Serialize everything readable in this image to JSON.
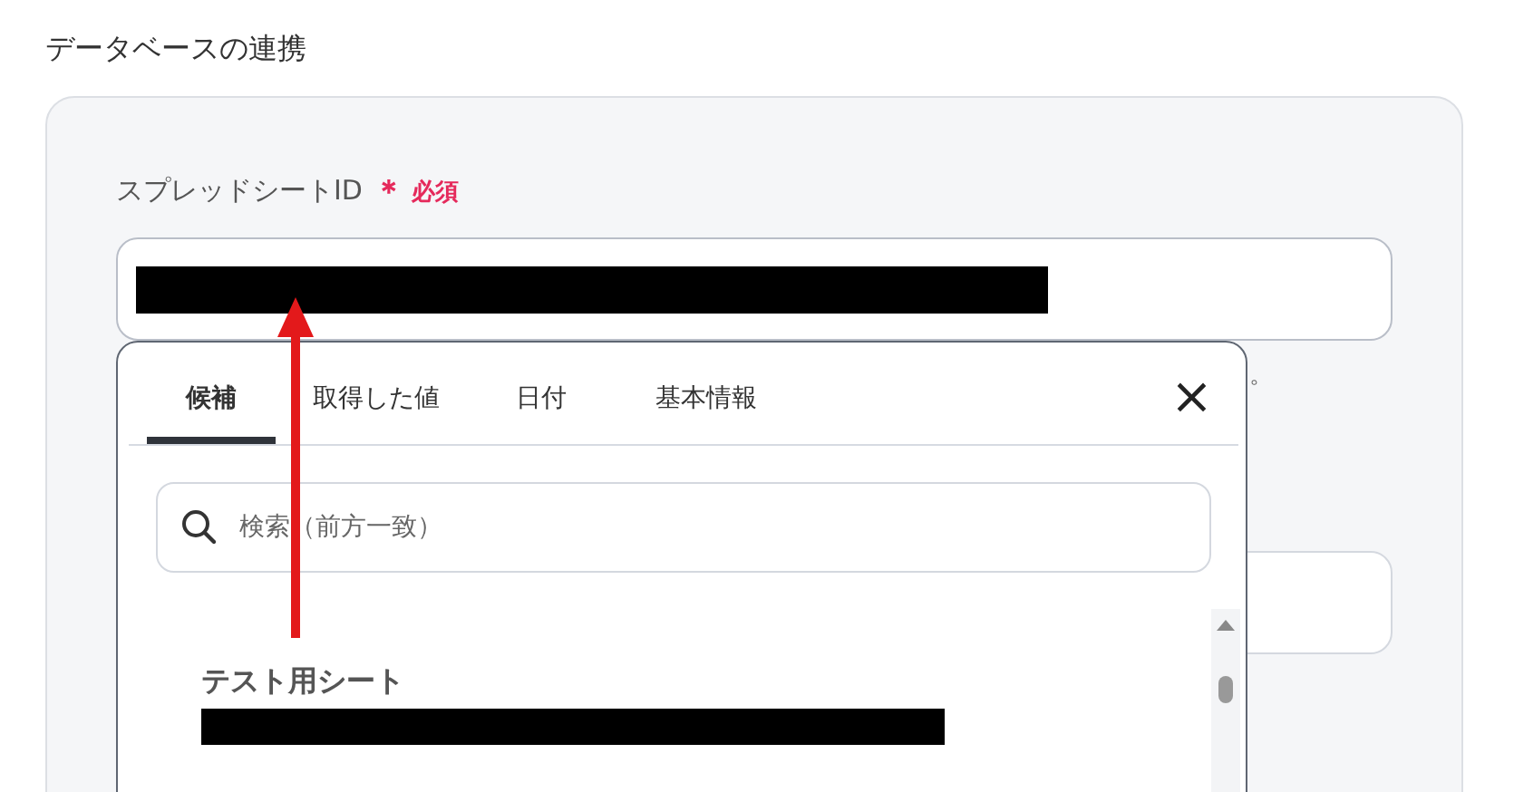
{
  "section_title": "データベースの連携",
  "field": {
    "label": "スプレッドシートID",
    "required_mark": "＊",
    "required_text": "必須",
    "hint_visible": "。"
  },
  "popup": {
    "tabs": [
      {
        "label": "候補",
        "selected": true
      },
      {
        "label": "取得した値",
        "selected": false
      },
      {
        "label": "日付",
        "selected": false
      },
      {
        "label": "基本情報",
        "selected": false
      }
    ],
    "close": "×",
    "search": {
      "placeholder": "検索（前方一致）"
    },
    "items": [
      {
        "title": "テスト用シート"
      }
    ]
  }
}
